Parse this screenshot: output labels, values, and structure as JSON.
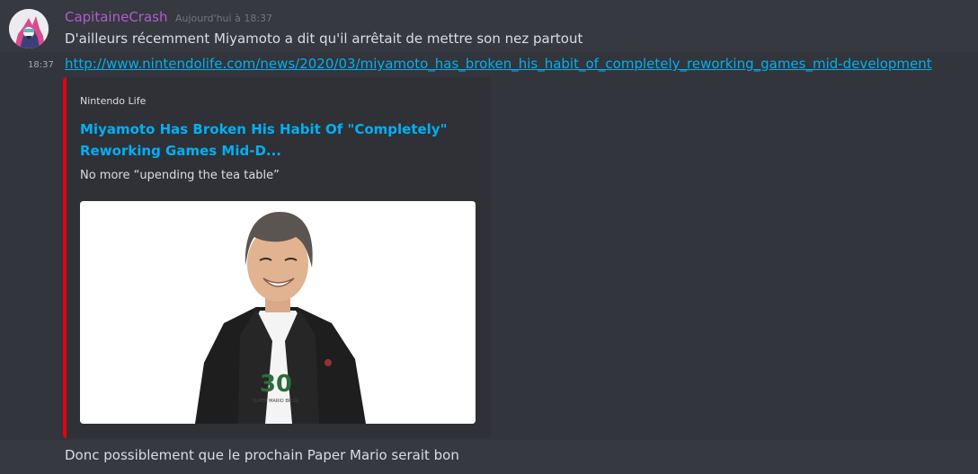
{
  "message": {
    "author": "CapitaineCrash",
    "timestamp": "Aujourd'hui à 18:37",
    "side_time": "18:37",
    "line1": "D'ailleurs récemment Miyamoto a dit qu'il arrêtait de mettre son nez partout",
    "link": "http://www.nintendolife.com/news/2020/03/miyamoto_has_broken_his_habit_of_completely_reworking_games_mid-development",
    "line3": "Donc possiblement que le prochain Paper Mario serait bon",
    "author_color": "#b15ccf"
  },
  "embed": {
    "provider": "Nintendo Life",
    "title": "Miyamoto Has Broken His Habit Of \"Completely\" Reworking Games Mid-D...",
    "description": "No more “upending the tea table”",
    "accent_color": "#e60012",
    "image_icon": "person-photo",
    "shirt_text_big": "30",
    "shirt_text_small": "SUPER MARIO BROS."
  }
}
